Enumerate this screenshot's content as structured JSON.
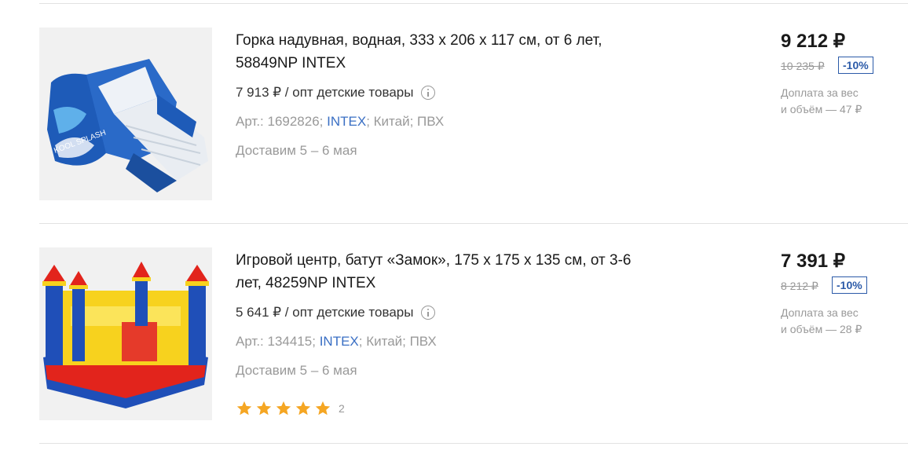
{
  "products": [
    {
      "title_line1": "Горка надувная, водная, 333 х 206 х 117 см, от 6 лет,",
      "title_line2": "58849NP INTEX",
      "wholesale": "7 913 ₽ / опт детские товары",
      "meta_prefix": "Арт.: 1692826;",
      "brand": "INTEX",
      "meta_suffix": "; Китай; ПВХ",
      "delivery": "Доставим 5 – 6 мая",
      "price": "9 212 ₽",
      "old_price": "10 235 ₽",
      "discount": "-10%",
      "surcharge_line1": "Доплата за вес",
      "surcharge_line2": "и объём — 47 ₽",
      "image_icon": "inflatable-water-slide-image"
    },
    {
      "title_line1": "Игровой центр, батут «Замок», 175 х 175 х 135 см, от 3-6",
      "title_line2": "лет, 48259NP INTEX",
      "wholesale": "5 641 ₽ / опт детские товары",
      "meta_prefix": "Арт.: 134415;",
      "brand": "INTEX",
      "meta_suffix": "; Китай; ПВХ",
      "delivery": "Доставим 5 – 6 мая",
      "price": "7 391 ₽",
      "old_price": "8 212 ₽",
      "discount": "-10%",
      "surcharge_line1": "Доплата за вес",
      "surcharge_line2": "и объём — 28 ₽",
      "rating": 5,
      "review_count": "2",
      "image_icon": "inflatable-castle-bouncer-image"
    }
  ],
  "colors": {
    "link": "#3a6fc4",
    "discount": "#2b5aa8",
    "star": "#f5a623",
    "muted": "#999999"
  }
}
